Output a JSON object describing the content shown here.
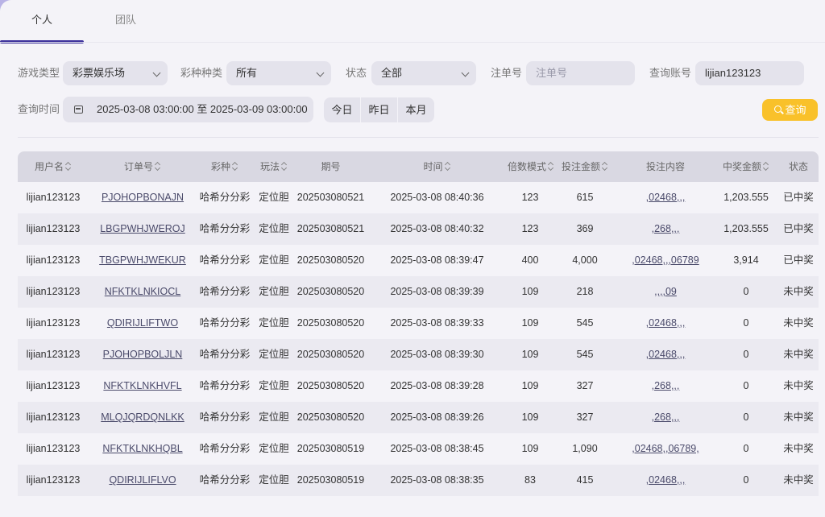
{
  "tabs": [
    {
      "label": "个人",
      "active": true
    },
    {
      "label": "团队",
      "active": false
    }
  ],
  "filters": {
    "game_type_label": "游戏类型",
    "game_type_value": "彩票娱乐场",
    "lottery_kind_label": "彩种种类",
    "lottery_kind_value": "所有",
    "status_label": "状态",
    "status_value": "全部",
    "order_no_label": "注单号",
    "order_no_placeholder": "注单号",
    "account_label": "查询账号",
    "account_value": "lijian123123",
    "time_label": "查询时间",
    "time_range": "2025-03-08 03:00:00 至 2025-03-09 03:00:00",
    "quick_ranges": [
      "今日",
      "昨日",
      "本月"
    ],
    "query_button": "查询"
  },
  "colors": {
    "accent": "#3a2f9a",
    "query_button": "#f9c12a"
  },
  "table": {
    "headers": [
      "用户名",
      "订单号",
      "彩种",
      "玩法",
      "期号",
      "时间",
      "倍数模式",
      "投注金额",
      "投注内容",
      "中奖金额",
      "状态"
    ],
    "rows": [
      [
        "lijian123123",
        "PJOHOPBONAJN",
        "哈希分分彩",
        "定位胆",
        "202503080521",
        "2025-03-08 08:40:36",
        "123",
        "615",
        ",02468,,,",
        "1,203.555",
        "已中奖"
      ],
      [
        "lijian123123",
        "LBGPWHJWEROJ",
        "哈希分分彩",
        "定位胆",
        "202503080521",
        "2025-03-08 08:40:32",
        "123",
        "369",
        ",268,,,",
        "1,203.555",
        "已中奖"
      ],
      [
        "lijian123123",
        "TBGPWHJWEKUR",
        "哈希分分彩",
        "定位胆",
        "202503080520",
        "2025-03-08 08:39:47",
        "400",
        "4,000",
        ",02468,,,06789",
        "3,914",
        "已中奖"
      ],
      [
        "lijian123123",
        "NFKTKLNKIOCL",
        "哈希分分彩",
        "定位胆",
        "202503080520",
        "2025-03-08 08:39:39",
        "109",
        "218",
        ",,,,09",
        "0",
        "未中奖"
      ],
      [
        "lijian123123",
        "QDIRIJLIFTWO",
        "哈希分分彩",
        "定位胆",
        "202503080520",
        "2025-03-08 08:39:33",
        "109",
        "545",
        ",02468,,,",
        "0",
        "未中奖"
      ],
      [
        "lijian123123",
        "PJOHOPBOLJLN",
        "哈希分分彩",
        "定位胆",
        "202503080520",
        "2025-03-08 08:39:30",
        "109",
        "545",
        ",02468,,,",
        "0",
        "未中奖"
      ],
      [
        "lijian123123",
        "NFKTKLNKHVFL",
        "哈希分分彩",
        "定位胆",
        "202503080520",
        "2025-03-08 08:39:28",
        "109",
        "327",
        ",268,,,",
        "0",
        "未中奖"
      ],
      [
        "lijian123123",
        "MLQJQRDQNLKK",
        "哈希分分彩",
        "定位胆",
        "202503080520",
        "2025-03-08 08:39:26",
        "109",
        "327",
        ",268,,,",
        "0",
        "未中奖"
      ],
      [
        "lijian123123",
        "NFKTKLNKHQBL",
        "哈希分分彩",
        "定位胆",
        "202503080519",
        "2025-03-08 08:38:45",
        "109",
        "1,090",
        ",02468,,06789,",
        "0",
        "未中奖"
      ],
      [
        "lijian123123",
        "QDIRIJLIFLVO",
        "哈希分分彩",
        "定位胆",
        "202503080519",
        "2025-03-08 08:38:35",
        "83",
        "415",
        ",02468,,,",
        "0",
        "未中奖"
      ]
    ]
  }
}
